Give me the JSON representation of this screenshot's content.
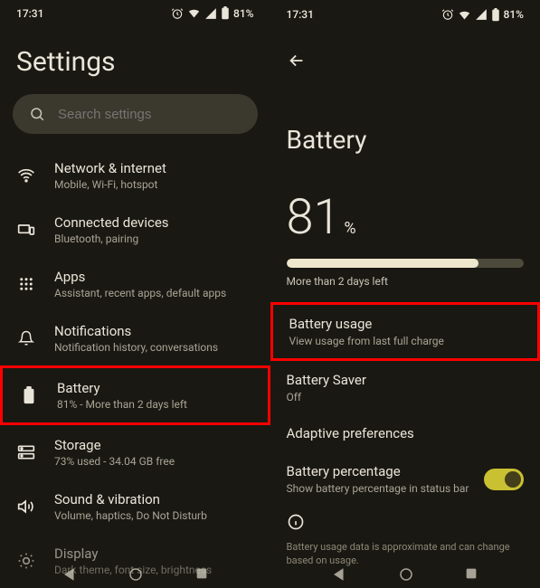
{
  "status": {
    "time": "17:31",
    "battery": "81%"
  },
  "left": {
    "title": "Settings",
    "search_placeholder": "Search settings",
    "items": [
      {
        "title": "Network & internet",
        "sub": "Mobile, Wi-Fi, hotspot"
      },
      {
        "title": "Connected devices",
        "sub": "Bluetooth, pairing"
      },
      {
        "title": "Apps",
        "sub": "Assistant, recent apps, default apps"
      },
      {
        "title": "Notifications",
        "sub": "Notification history, conversations"
      },
      {
        "title": "Battery",
        "sub": "81% - More than 2 days left"
      },
      {
        "title": "Storage",
        "sub": "73% used - 34.04 GB free"
      },
      {
        "title": "Sound & vibration",
        "sub": "Volume, haptics, Do Not Disturb"
      },
      {
        "title": "Display",
        "sub": "Dark theme, font size, brightness"
      }
    ]
  },
  "right": {
    "title": "Battery",
    "percent": "81",
    "percent_sym": "%",
    "progress": 81,
    "estimate": "More than 2 days left",
    "items": [
      {
        "title": "Battery usage",
        "sub": "View usage from last full charge"
      },
      {
        "title": "Battery Saver",
        "sub": "Off"
      },
      {
        "title": "Adaptive preferences",
        "sub": ""
      },
      {
        "title": "Battery percentage",
        "sub": "Show battery percentage in status bar"
      }
    ],
    "footnote": "Battery usage data is approximate and can change based on usage."
  }
}
